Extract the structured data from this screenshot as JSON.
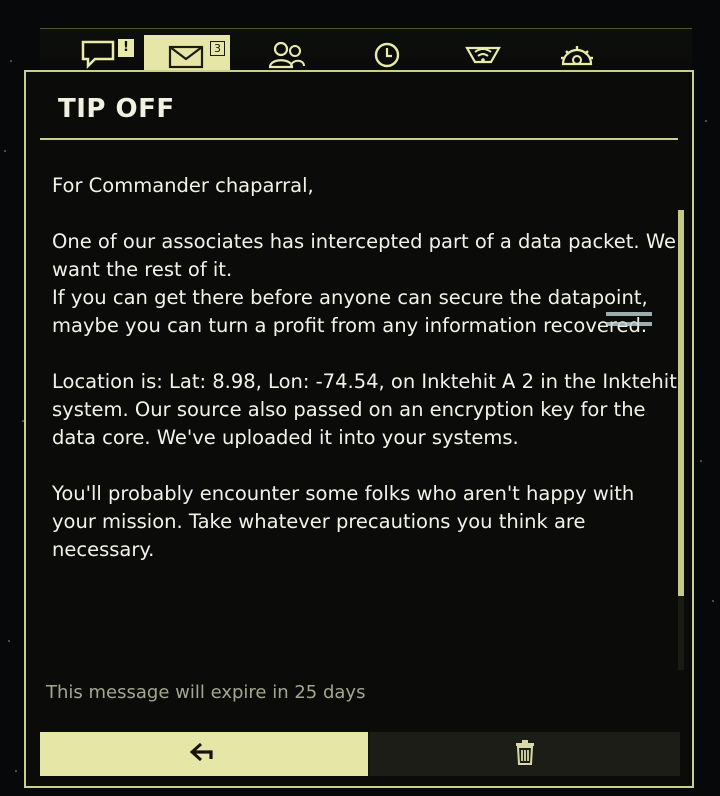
{
  "tabs": [
    {
      "id": "inbox-alerts",
      "icon": "speech-bubble-icon",
      "badge": "!"
    },
    {
      "id": "messages",
      "icon": "envelope-icon",
      "badge": "3",
      "active": true
    },
    {
      "id": "contacts",
      "icon": "people-icon"
    },
    {
      "id": "timer",
      "icon": "clock-icon"
    },
    {
      "id": "comms",
      "icon": "signal-icon"
    },
    {
      "id": "settings",
      "icon": "gear-icon"
    }
  ],
  "message": {
    "title": "TIP OFF",
    "greeting": "For Commander chaparral,",
    "para1": "One of our associates has intercepted part of a data packet. We want the rest of it.\nIf you can get there before anyone can secure the datapoint, maybe you can turn a profit from any information recovered.",
    "para2": "Location is: Lat: 8.98, Lon: -74.54, on Inktehit A 2 in the Inktehit system. Our source also passed on an encryption key for the data core. We've uploaded it into your systems.",
    "para3": "You'll probably encounter some folks who aren't happy with your mission. Take whatever precautions you think are necessary.",
    "expiry": "This message will expire in 25 days"
  },
  "actions": {
    "back": "back-arrow-icon",
    "delete": "trash-icon"
  },
  "colors": {
    "accent": "#e6e7a6",
    "frame": "#c9d08a",
    "text": "#f2f3e8",
    "muted": "#a5a690"
  }
}
